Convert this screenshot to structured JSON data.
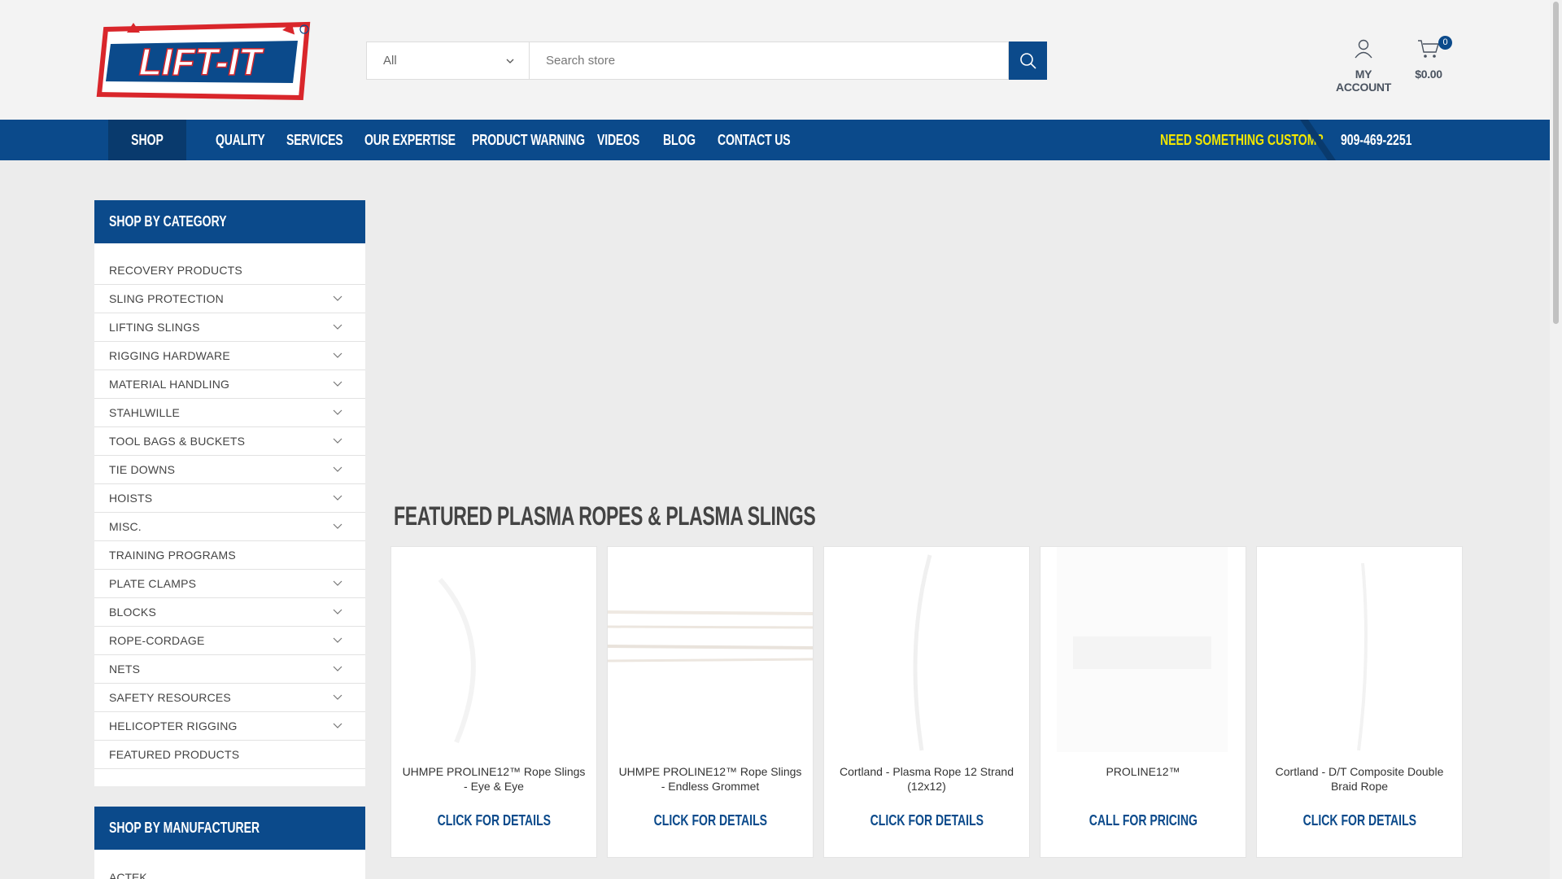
{
  "header": {
    "logo_text": "LIFT-IT",
    "search": {
      "category_value": "All",
      "placeholder": "Search store"
    },
    "account_label": "MY ACCOUNT",
    "cart": {
      "count": "0",
      "total": "$0.00"
    }
  },
  "nav": {
    "shop": "SHOP",
    "items": [
      "QUALITY",
      "SERVICES",
      "OUR EXPERTISE",
      "PRODUCT WARNING",
      "VIDEOS",
      "BLOG",
      "CONTACT US"
    ],
    "custom": "NEED SOMETHING CUSTOM?",
    "phone": "909-469-2251"
  },
  "sidebar": {
    "title": "SHOP BY CATEGORY",
    "items": [
      {
        "label": "RECOVERY PRODUCTS",
        "has_children": false
      },
      {
        "label": "SLING PROTECTION",
        "has_children": true
      },
      {
        "label": "LIFTING SLINGS",
        "has_children": true
      },
      {
        "label": "RIGGING HARDWARE",
        "has_children": true
      },
      {
        "label": "MATERIAL HANDLING",
        "has_children": true
      },
      {
        "label": "STAHLWILLE",
        "has_children": true
      },
      {
        "label": "TOOL BAGS & BUCKETS",
        "has_children": true
      },
      {
        "label": "TIE DOWNS",
        "has_children": true
      },
      {
        "label": "HOISTS",
        "has_children": true
      },
      {
        "label": "MISC.",
        "has_children": true
      },
      {
        "label": "TRAINING PROGRAMS",
        "has_children": false
      },
      {
        "label": "PLATE CLAMPS",
        "has_children": true
      },
      {
        "label": "BLOCKS",
        "has_children": true
      },
      {
        "label": "ROPE-CORDAGE",
        "has_children": true
      },
      {
        "label": "NETS",
        "has_children": true
      },
      {
        "label": "SAFETY RESOURCES",
        "has_children": true
      },
      {
        "label": "HELICOPTER RIGGING",
        "has_children": true
      },
      {
        "label": "FEATURED PRODUCTS",
        "has_children": false
      }
    ],
    "manufacturer_title": "SHOP BY MANUFACTURER",
    "manufacturer_first": "ACTEK"
  },
  "main": {
    "section_title": "FEATURED PLASMA ROPES & PLASMA SLINGS",
    "products": [
      {
        "name": "UHMPE PROLINE12™ Rope Slings - Eye & Eye",
        "cta": "CLICK FOR DETAILS"
      },
      {
        "name": "UHMPE PROLINE12™ Rope Slings - Endless Grommet",
        "cta": "CLICK FOR DETAILS"
      },
      {
        "name": "Cortland - Plasma Rope 12 Strand (12x12)",
        "cta": "CLICK FOR DETAILS"
      },
      {
        "name": "PROLINE12™",
        "cta": "CALL FOR PRICING"
      },
      {
        "name": "Cortland - D/T Composite Double Braid Rope",
        "cta": "CLICK FOR DETAILS"
      }
    ]
  },
  "colors": {
    "brand_blue": "#0b4a8b",
    "accent_yellow": "#f2e600",
    "logo_red": "#d9262b"
  }
}
